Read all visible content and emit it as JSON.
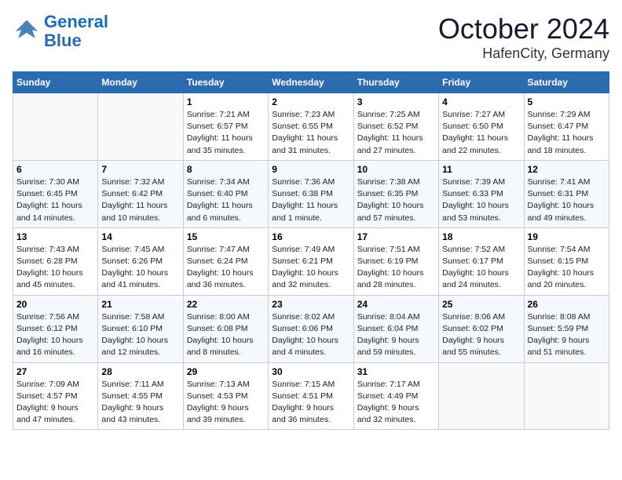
{
  "header": {
    "logo_line1": "General",
    "logo_line2": "Blue",
    "month": "October 2024",
    "location": "HafenCity, Germany"
  },
  "weekdays": [
    "Sunday",
    "Monday",
    "Tuesday",
    "Wednesday",
    "Thursday",
    "Friday",
    "Saturday"
  ],
  "weeks": [
    [
      {
        "day": "",
        "info": ""
      },
      {
        "day": "",
        "info": ""
      },
      {
        "day": "1",
        "info": "Sunrise: 7:21 AM\nSunset: 6:57 PM\nDaylight: 11 hours\nand 35 minutes."
      },
      {
        "day": "2",
        "info": "Sunrise: 7:23 AM\nSunset: 6:55 PM\nDaylight: 11 hours\nand 31 minutes."
      },
      {
        "day": "3",
        "info": "Sunrise: 7:25 AM\nSunset: 6:52 PM\nDaylight: 11 hours\nand 27 minutes."
      },
      {
        "day": "4",
        "info": "Sunrise: 7:27 AM\nSunset: 6:50 PM\nDaylight: 11 hours\nand 22 minutes."
      },
      {
        "day": "5",
        "info": "Sunrise: 7:29 AM\nSunset: 6:47 PM\nDaylight: 11 hours\nand 18 minutes."
      }
    ],
    [
      {
        "day": "6",
        "info": "Sunrise: 7:30 AM\nSunset: 6:45 PM\nDaylight: 11 hours\nand 14 minutes."
      },
      {
        "day": "7",
        "info": "Sunrise: 7:32 AM\nSunset: 6:42 PM\nDaylight: 11 hours\nand 10 minutes."
      },
      {
        "day": "8",
        "info": "Sunrise: 7:34 AM\nSunset: 6:40 PM\nDaylight: 11 hours\nand 6 minutes."
      },
      {
        "day": "9",
        "info": "Sunrise: 7:36 AM\nSunset: 6:38 PM\nDaylight: 11 hours\nand 1 minute."
      },
      {
        "day": "10",
        "info": "Sunrise: 7:38 AM\nSunset: 6:35 PM\nDaylight: 10 hours\nand 57 minutes."
      },
      {
        "day": "11",
        "info": "Sunrise: 7:39 AM\nSunset: 6:33 PM\nDaylight: 10 hours\nand 53 minutes."
      },
      {
        "day": "12",
        "info": "Sunrise: 7:41 AM\nSunset: 6:31 PM\nDaylight: 10 hours\nand 49 minutes."
      }
    ],
    [
      {
        "day": "13",
        "info": "Sunrise: 7:43 AM\nSunset: 6:28 PM\nDaylight: 10 hours\nand 45 minutes."
      },
      {
        "day": "14",
        "info": "Sunrise: 7:45 AM\nSunset: 6:26 PM\nDaylight: 10 hours\nand 41 minutes."
      },
      {
        "day": "15",
        "info": "Sunrise: 7:47 AM\nSunset: 6:24 PM\nDaylight: 10 hours\nand 36 minutes."
      },
      {
        "day": "16",
        "info": "Sunrise: 7:49 AM\nSunset: 6:21 PM\nDaylight: 10 hours\nand 32 minutes."
      },
      {
        "day": "17",
        "info": "Sunrise: 7:51 AM\nSunset: 6:19 PM\nDaylight: 10 hours\nand 28 minutes."
      },
      {
        "day": "18",
        "info": "Sunrise: 7:52 AM\nSunset: 6:17 PM\nDaylight: 10 hours\nand 24 minutes."
      },
      {
        "day": "19",
        "info": "Sunrise: 7:54 AM\nSunset: 6:15 PM\nDaylight: 10 hours\nand 20 minutes."
      }
    ],
    [
      {
        "day": "20",
        "info": "Sunrise: 7:56 AM\nSunset: 6:12 PM\nDaylight: 10 hours\nand 16 minutes."
      },
      {
        "day": "21",
        "info": "Sunrise: 7:58 AM\nSunset: 6:10 PM\nDaylight: 10 hours\nand 12 minutes."
      },
      {
        "day": "22",
        "info": "Sunrise: 8:00 AM\nSunset: 6:08 PM\nDaylight: 10 hours\nand 8 minutes."
      },
      {
        "day": "23",
        "info": "Sunrise: 8:02 AM\nSunset: 6:06 PM\nDaylight: 10 hours\nand 4 minutes."
      },
      {
        "day": "24",
        "info": "Sunrise: 8:04 AM\nSunset: 6:04 PM\nDaylight: 9 hours\nand 59 minutes."
      },
      {
        "day": "25",
        "info": "Sunrise: 8:06 AM\nSunset: 6:02 PM\nDaylight: 9 hours\nand 55 minutes."
      },
      {
        "day": "26",
        "info": "Sunrise: 8:08 AM\nSunset: 5:59 PM\nDaylight: 9 hours\nand 51 minutes."
      }
    ],
    [
      {
        "day": "27",
        "info": "Sunrise: 7:09 AM\nSunset: 4:57 PM\nDaylight: 9 hours\nand 47 minutes."
      },
      {
        "day": "28",
        "info": "Sunrise: 7:11 AM\nSunset: 4:55 PM\nDaylight: 9 hours\nand 43 minutes."
      },
      {
        "day": "29",
        "info": "Sunrise: 7:13 AM\nSunset: 4:53 PM\nDaylight: 9 hours\nand 39 minutes."
      },
      {
        "day": "30",
        "info": "Sunrise: 7:15 AM\nSunset: 4:51 PM\nDaylight: 9 hours\nand 36 minutes."
      },
      {
        "day": "31",
        "info": "Sunrise: 7:17 AM\nSunset: 4:49 PM\nDaylight: 9 hours\nand 32 minutes."
      },
      {
        "day": "",
        "info": ""
      },
      {
        "day": "",
        "info": ""
      }
    ]
  ]
}
